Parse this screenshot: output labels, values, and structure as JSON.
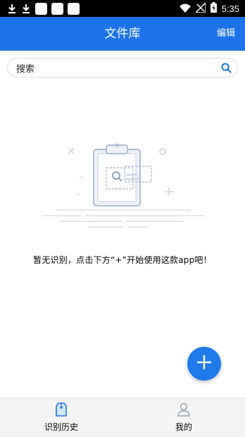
{
  "status_bar": {
    "time": "5:35",
    "left_icons": [
      "download-icon",
      "download-icon",
      "app-icon",
      "app-icon",
      "app-icon"
    ],
    "right_icons": [
      "wifi-icon",
      "signal-icon",
      "battery-icon"
    ]
  },
  "app_bar": {
    "title": "文件库",
    "edit_label": "编辑",
    "background": "#1e73e8"
  },
  "search": {
    "text": "搜索",
    "icon": "search-icon",
    "icon_color": "#1e73e8"
  },
  "empty_state": {
    "illustration": "empty-clipboard-illustration",
    "message": "暂无识别，点击下方“+”开始使用这款app吧！"
  },
  "fab": {
    "icon": "plus-icon",
    "color": "#1f7ae9"
  },
  "bottom_nav": {
    "tabs": [
      {
        "label": "识别历史",
        "icon": "tag-icon",
        "active": true
      },
      {
        "label": "我的",
        "icon": "user-icon",
        "active": false
      }
    ],
    "active_color": "#1e73e8"
  }
}
